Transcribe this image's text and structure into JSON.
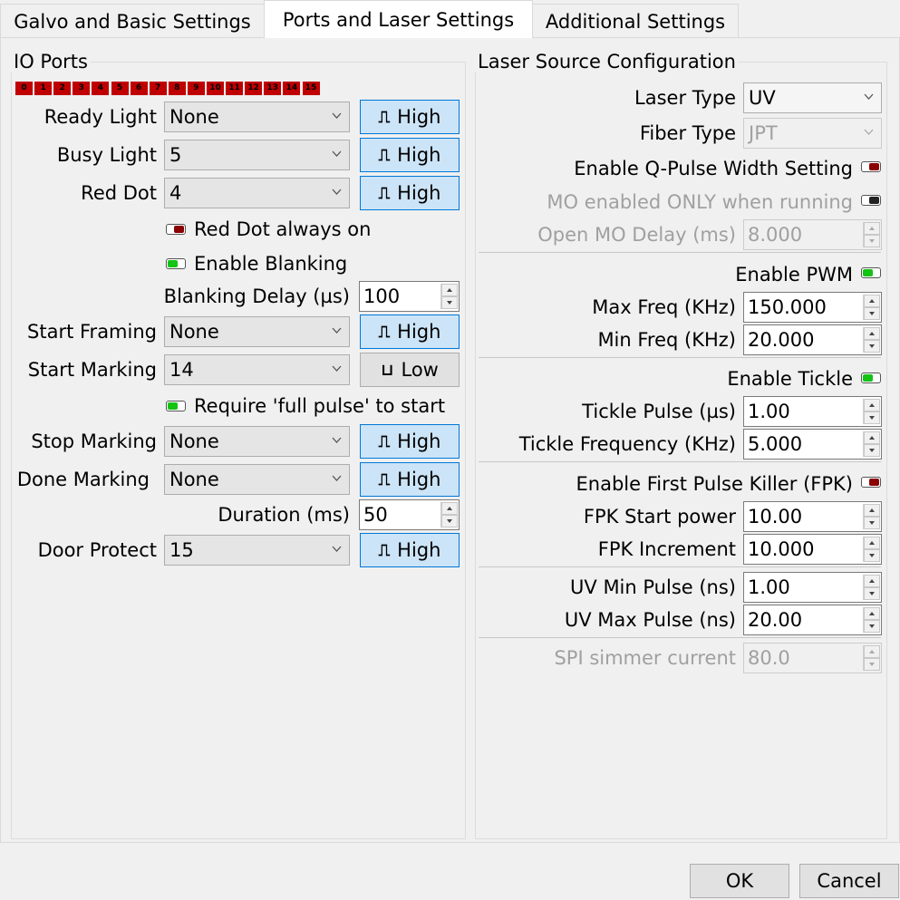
{
  "tabs": [
    {
      "label": "Galvo and Basic Settings"
    },
    {
      "label": "Ports and Laser Settings"
    },
    {
      "label": "Additional Settings"
    }
  ],
  "io_ports": {
    "title": "IO Ports",
    "port_indicators": [
      "0",
      "1",
      "2",
      "3",
      "4",
      "5",
      "6",
      "7",
      "8",
      "9",
      "10",
      "11",
      "12",
      "13",
      "14",
      "15"
    ],
    "port_color": "#c00000",
    "ready_light": {
      "label": "Ready Light",
      "value": "None",
      "level": "High"
    },
    "busy_light": {
      "label": "Busy Light",
      "value": "5",
      "level": "High"
    },
    "red_dot": {
      "label": "Red Dot",
      "value": "4",
      "level": "High"
    },
    "red_dot_always_on": {
      "label": "Red Dot always on",
      "state": "off"
    },
    "enable_blanking": {
      "label": "Enable Blanking",
      "state": "on"
    },
    "blanking_delay": {
      "label": "Blanking Delay (µs)",
      "value": "100"
    },
    "start_framing": {
      "label": "Start Framing",
      "value": "None",
      "level": "High"
    },
    "start_marking": {
      "label": "Start Marking",
      "value": "14",
      "level": "Low"
    },
    "require_full_pulse": {
      "label": "Require 'full pulse' to start",
      "state": "on"
    },
    "stop_marking": {
      "label": "Stop Marking",
      "value": "None",
      "level": "High"
    },
    "done_marking": {
      "label": "Done Marking",
      "value": "None",
      "level": "High"
    },
    "duration": {
      "label": "Duration (ms)",
      "value": "50"
    },
    "door_protect": {
      "label": "Door Protect",
      "value": "15",
      "level": "High"
    }
  },
  "laser": {
    "title": "Laser Source Configuration",
    "laser_type": {
      "label": "Laser Type",
      "value": "UV"
    },
    "fiber_type": {
      "label": "Fiber Type",
      "value": "JPT"
    },
    "enable_q_pulse": {
      "label": "Enable Q-Pulse Width Setting",
      "state": "off"
    },
    "mo_enabled_running": {
      "label": "MO enabled ONLY when running",
      "state": "off"
    },
    "open_mo_delay": {
      "label": "Open MO Delay (ms)",
      "value": "8.000"
    },
    "enable_pwm": {
      "label": "Enable PWM",
      "state": "on"
    },
    "max_freq": {
      "label": "Max Freq (KHz)",
      "value": "150.000"
    },
    "min_freq": {
      "label": "Min Freq (KHz)",
      "value": "20.000"
    },
    "enable_tickle": {
      "label": "Enable Tickle",
      "state": "on"
    },
    "tickle_pulse": {
      "label": "Tickle Pulse (µs)",
      "value": "1.00"
    },
    "tickle_frequency": {
      "label": "Tickle Frequency (KHz)",
      "value": "5.000"
    },
    "enable_fpk": {
      "label": "Enable First Pulse Killer (FPK)",
      "state": "off"
    },
    "fpk_start_power": {
      "label": "FPK Start power",
      "value": "10.00"
    },
    "fpk_increment": {
      "label": "FPK Increment",
      "value": "10.000"
    },
    "uv_min_pulse": {
      "label": "UV Min Pulse (ns)",
      "value": "1.00"
    },
    "uv_max_pulse": {
      "label": "UV Max Pulse (ns)",
      "value": "20.00"
    },
    "spi_simmer_current": {
      "label": "SPI simmer current",
      "value": "80.0"
    }
  },
  "footer": {
    "ok_label": "OK",
    "cancel_label": "Cancel"
  },
  "colors": {
    "accent_button": "#cce4f7",
    "accent_border": "#0078d7",
    "toggle_on": "#14c314",
    "toggle_off": "#8b0000"
  }
}
